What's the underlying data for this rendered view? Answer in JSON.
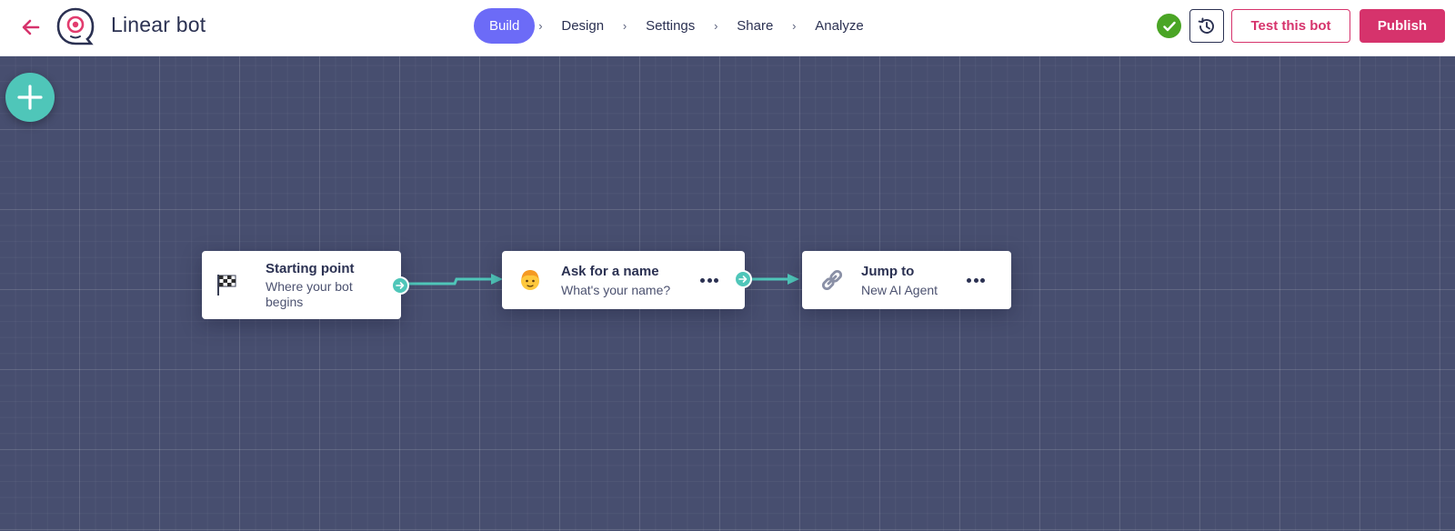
{
  "header": {
    "back_icon": "arrow-left-icon",
    "logo_icon": "bot-logo-icon",
    "app_title": "Linear bot",
    "steps": [
      {
        "label": "Build",
        "active": true
      },
      {
        "label": "Design",
        "active": false
      },
      {
        "label": "Settings",
        "active": false
      },
      {
        "label": "Share",
        "active": false
      },
      {
        "label": "Analyze",
        "active": false
      }
    ],
    "step_separator": "›",
    "status_icon": "check-circle-icon",
    "history_icon": "history-icon",
    "test_label": "Test this bot",
    "publish_label": "Publish"
  },
  "canvas": {
    "add_icon": "plus-icon",
    "nodes": [
      {
        "id": "start",
        "icon": "checkered-flag-icon",
        "title": "Starting point",
        "subtitle": "Where your bot begins"
      },
      {
        "id": "ask-name",
        "icon": "person-face-icon",
        "title": "Ask for a name",
        "subtitle": "What's your name?"
      },
      {
        "id": "jump-to",
        "icon": "link-icon",
        "title": "Jump to",
        "subtitle": "New AI Agent"
      }
    ]
  },
  "colors": {
    "accent": "#6c6bf7",
    "brand": "#d6336c",
    "connector": "#4fc6b9",
    "canvas_bg": "#474e6f",
    "success": "#4aa525"
  }
}
